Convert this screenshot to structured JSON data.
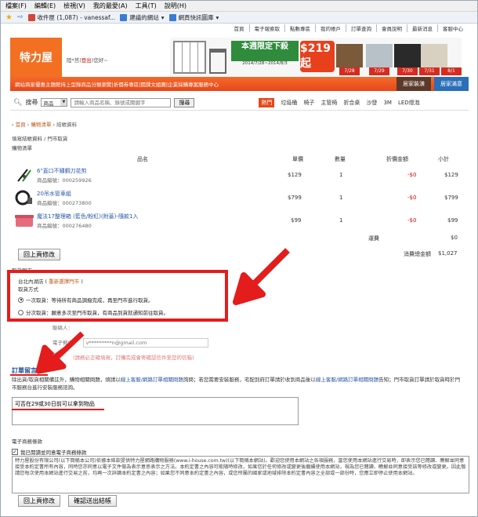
{
  "browser": {
    "menu": [
      "檔案(F)",
      "編輯(E)",
      "檢視(V)",
      "我的最愛(A)",
      "工具(T)",
      "說明(H)"
    ],
    "favorites": [
      {
        "label": "收件匣 (1,087) - vanessaf...",
        "color": "#d44638"
      },
      {
        "label": "建議的網站",
        "color": "#3a7bd5"
      },
      {
        "label": "網頁快訊圖庫",
        "color": "#3a7bd5"
      }
    ]
  },
  "site": {
    "top_links": [
      "首頁",
      "電子報索取",
      "點數專區",
      "我的帳戶",
      "訂單查詢",
      "會員說明",
      "最新消息",
      "客服中心"
    ],
    "logo": "特力屋",
    "greeting_prefix": "陸*莒(",
    "greeting_logout": "登出",
    "greeting_suffix": ")您好~",
    "banner": {
      "headline": "本週限定下殺",
      "dates": "2014/7/28~2014/8/3",
      "price": "$219起",
      "tags": [
        "7/28",
        "7/29",
        "7/30",
        "7/31",
        "8/1"
      ]
    },
    "nav_text": "網站商家優惠主題館持上型錄商品分類瀏覽|折價券專區|開課文組團|企業採購專案服務中心",
    "nav_right": [
      "居家裝潢",
      "居家滿意"
    ],
    "search": {
      "label": "搜尋",
      "category": "商品",
      "placeholder": "請輸入商品名稱、錄號或關鍵字",
      "button": "搜尋",
      "hot_label": "熱門",
      "hot": [
        "垃圾桶",
        "椅子",
        "主管椅",
        "折合桌",
        "沙發",
        "3M",
        "LED燈泡"
      ]
    }
  },
  "breadcrumb": [
    "首頁",
    "購物清單",
    "結帳資料"
  ],
  "subtitle": "填寫結帳資料 / 門市取貨",
  "cart": {
    "title": "購物清單",
    "headers": {
      "name": "品名",
      "price": "單價",
      "qty": "數量",
      "discount": "折價金額",
      "subtotal": "小計"
    },
    "items": [
      {
        "name": "6\"直口不鏽鋼刀花剪",
        "code": "商品編號：000259926",
        "price": "$129",
        "qty": "1",
        "discount": "-$0",
        "subtotal": "$129"
      },
      {
        "name": "20吊水管車組",
        "code": "商品編號：000273800",
        "price": "$799",
        "qty": "1",
        "discount": "-$0",
        "subtotal": "$799"
      },
      {
        "name": "魔法17整理箱 (藍色/粉紅)(附蓋)-隨款1入",
        "code": "商品編號：000276480",
        "price": "$99",
        "qty": "1",
        "discount": "-$0",
        "subtotal": "$99"
      }
    ],
    "shipping_label": "運費",
    "shipping_value": "$0",
    "total_label": "消費總金額",
    "total_value": "$1,027"
  },
  "buttons": {
    "back": "回上頁修改",
    "confirm": "確認送出結帳"
  },
  "pickup": {
    "title": "取貨門市",
    "store": "台北內湖店",
    "reselect": "重新選擇門市",
    "method_label": "取貨方式",
    "options": [
      {
        "label": "一次取貨：等待所有商品調撥完成，再至門市進行取貨。",
        "selected": true
      },
      {
        "label": "分次取貨：願意多次至門市取貨，有商品到貨就通知前往取貨。",
        "selected": false
      }
    ]
  },
  "contact": {
    "name_label": "聯絡人：",
    "email_label": "電子郵件：",
    "email_value": "v*********n@gmail.com",
    "note": "(請務必正確填寫，訂購完成會寄確認信件至您的信箱)"
  },
  "memo": {
    "title": "訂單留言",
    "desc_1": "除出貨/取貨相關備註外，購物相關問題，煩請以",
    "link_1": "線上客服/網路訂單相關問題",
    "desc_2": "詢問；若您需要安裝服務，宅配到府訂單請於收到商品後以",
    "link_2": "線上客服/網路訂單相關問題",
    "desc_3": "告知；門市取貨訂單請於取貨時於門市服務台進行安裝服務諮詢。",
    "value": "可否在29或30日前可以拿到物品"
  },
  "terms": {
    "title": "電子商務條款",
    "checkbox": "我已閱讀並同意電子商務條款",
    "text": "特力屋股份有限公司(以下簡稱本公司)依據本條款提供特力屋網路購物服務(www.i-house.com.tw)(以下簡稱本網站)。歡迎您使用本網站之各項服務，當您使用本網站進行交易時，即表示您已閱讀、瞭解並同意接受本約定書所有內容，同時您亦同意以電子文件做為表示意思表示之方法。本約定書之內容可能隨時修改，如果您於任何修改或變更後繼續使用本網站，視為您已閱讀、瞭解並同意接受該等修改或變更。因此敬請您每次使用本網站進行交易之前，均再一次詳讀本約定書之內容；如果您不同意本約定書之內容，或您所屬的國家或地域排除本約定書內容之全部或一部份時，您應立即停止使用本網站。"
  }
}
